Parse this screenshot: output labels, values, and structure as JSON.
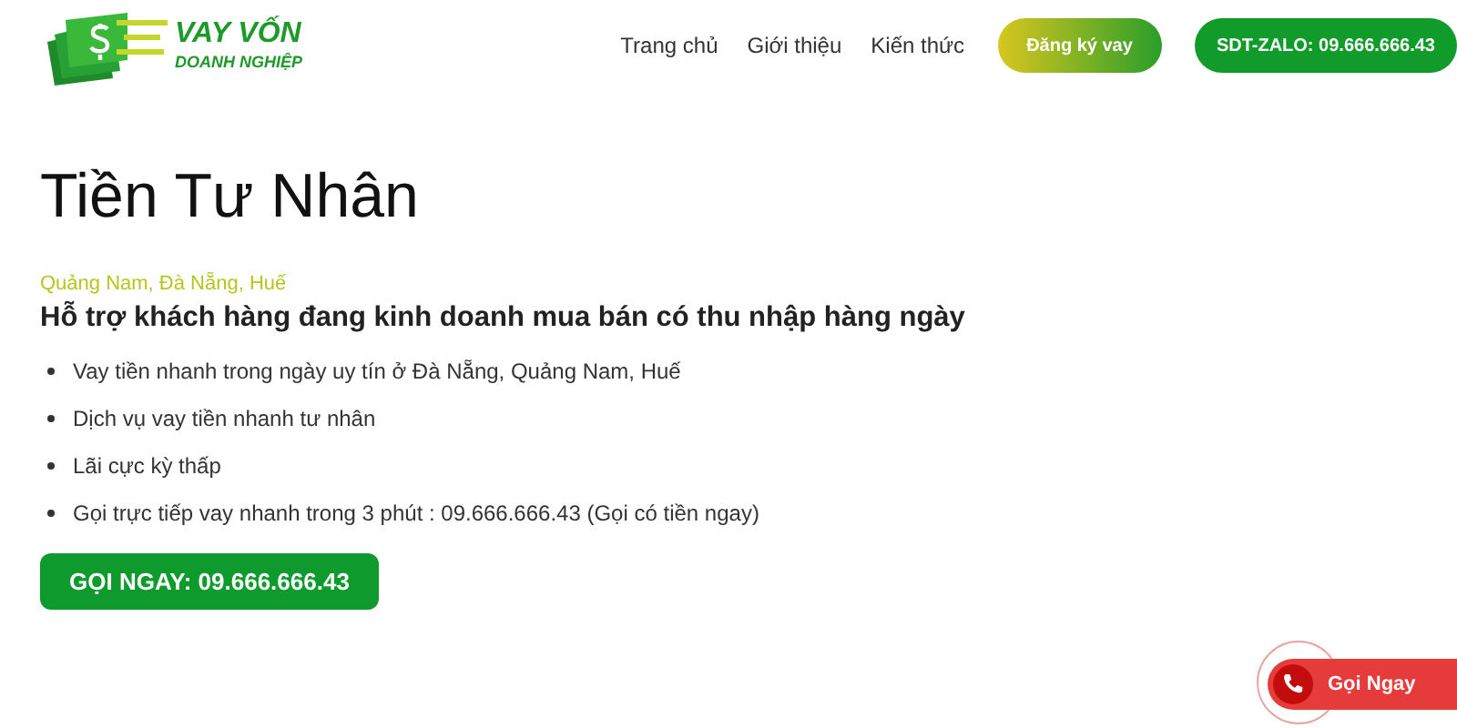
{
  "header": {
    "logo": {
      "line_1": "VAY VỐN",
      "line_2": "DOANH NGHIỆP"
    },
    "nav": [
      "Trang chủ",
      "Giới thiệu",
      "Kiến thức"
    ],
    "register_button": "Đăng ký vay",
    "phone_button": "SDT-ZALO: 09.666.666.43"
  },
  "main": {
    "title": "Tiền Tư Nhân",
    "region": "Quảng Nam, Đà Nẵng, Huế",
    "subtitle": "Hỗ trợ khách hàng đang kinh doanh mua bán có thu nhập hàng ngày",
    "bullets": [
      "Vay tiền nhanh trong ngày uy tín ở Đà Nẵng, Quảng Nam, Huế",
      "Dịch vụ vay tiền nhanh tư nhân",
      "Lãi cực kỳ thấp",
      "Gọi trực tiếp vay nhanh trong 3 phút : 09.666.666.43 (Gọi có tiền ngay)"
    ],
    "call_button": "GỌI NGAY: 09.666.666.43"
  },
  "floating_call": {
    "label": "Gọi Ngay"
  }
}
